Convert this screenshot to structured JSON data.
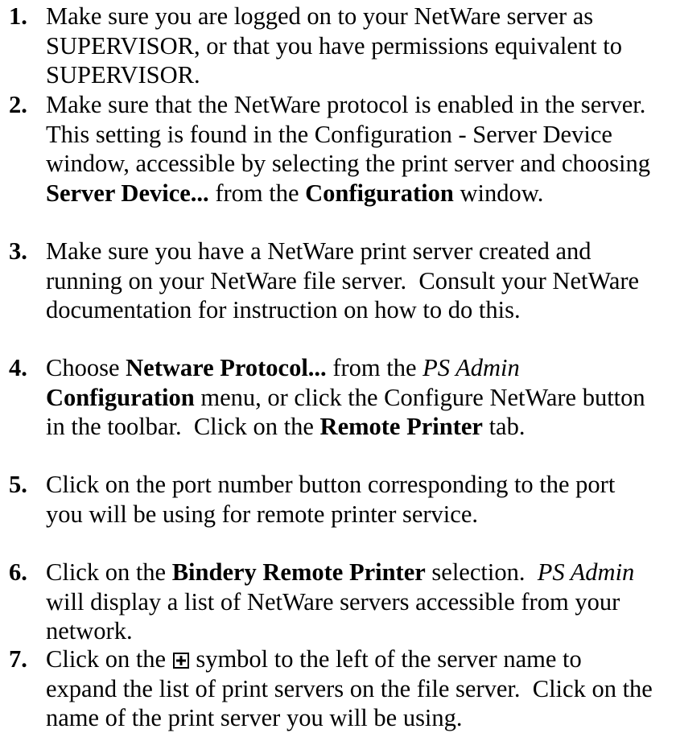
{
  "steps": [
    {
      "number": "1.",
      "lines": [
        [
          {
            "t": "Make sure you are logged on to your NetWare server as",
            "s": "n"
          }
        ],
        [
          {
            "t": "SUPERVISOR, or that you have permissions equivalent to",
            "s": "n"
          }
        ],
        [
          {
            "t": "SUPERVISOR.",
            "s": "n"
          }
        ]
      ]
    },
    {
      "number": "2.",
      "lines": [
        [
          {
            "t": "Make sure that the NetWare protocol is enabled in the server.",
            "s": "n"
          }
        ],
        [
          {
            "t": "This setting is found in the Configuration - Server Device",
            "s": "n"
          }
        ],
        [
          {
            "t": "window, accessible by selecting the print server and choosing",
            "s": "n"
          }
        ],
        [
          {
            "t": "Server Device...",
            "s": "b"
          },
          {
            "t": " from the ",
            "s": "n"
          },
          {
            "t": "Configuration",
            "s": "b"
          },
          {
            "t": " window.",
            "s": "n"
          }
        ]
      ]
    },
    {
      "number": "3.",
      "lines": [
        [
          {
            "t": "Make sure you have a NetWare print server created and",
            "s": "n"
          }
        ],
        [
          {
            "t": "running on your NetWare file server.  Consult your NetWare",
            "s": "n"
          }
        ],
        [
          {
            "t": "documentation for instruction on how to do this.",
            "s": "n"
          }
        ]
      ]
    },
    {
      "number": "4.",
      "lines": [
        [
          {
            "t": "Choose ",
            "s": "n"
          },
          {
            "t": "Netware Protocol...",
            "s": "b"
          },
          {
            "t": " from the ",
            "s": "n"
          },
          {
            "t": "PS Admin",
            "s": "i"
          }
        ],
        [
          {
            "t": "Configuration",
            "s": "b"
          },
          {
            "t": " menu, or click the Configure NetWare button",
            "s": "n"
          }
        ],
        [
          {
            "t": "in the toolbar.  Click on the ",
            "s": "n"
          },
          {
            "t": "Remote Printer",
            "s": "b"
          },
          {
            "t": " tab.",
            "s": "n"
          }
        ]
      ]
    },
    {
      "number": "5.",
      "lines": [
        [
          {
            "t": "Click on the port number button corresponding to the port",
            "s": "n"
          }
        ],
        [
          {
            "t": "you will be using for remote printer service.",
            "s": "n"
          }
        ]
      ]
    },
    {
      "number": "6.",
      "lines": [
        [
          {
            "t": "Click on the ",
            "s": "n"
          },
          {
            "t": "Bindery Remote Printer",
            "s": "b"
          },
          {
            "t": " selection.  ",
            "s": "n"
          },
          {
            "t": "PS Admin",
            "s": "i"
          }
        ],
        [
          {
            "t": "will display a list of NetWare servers accessible from your",
            "s": "n"
          }
        ],
        [
          {
            "t": "network.",
            "s": "n"
          }
        ]
      ]
    },
    {
      "number": "7.",
      "lines": [
        [
          {
            "t": "Click on the ",
            "s": "n"
          },
          {
            "icon": "expand-plus-icon"
          },
          {
            "t": " symbol to the left of the server name to",
            "s": "n"
          }
        ],
        [
          {
            "t": "expand the list of print servers on the file server.  Click on the",
            "s": "n"
          }
        ],
        [
          {
            "t": "name of the print server you will be using.",
            "s": "n"
          }
        ]
      ]
    }
  ]
}
